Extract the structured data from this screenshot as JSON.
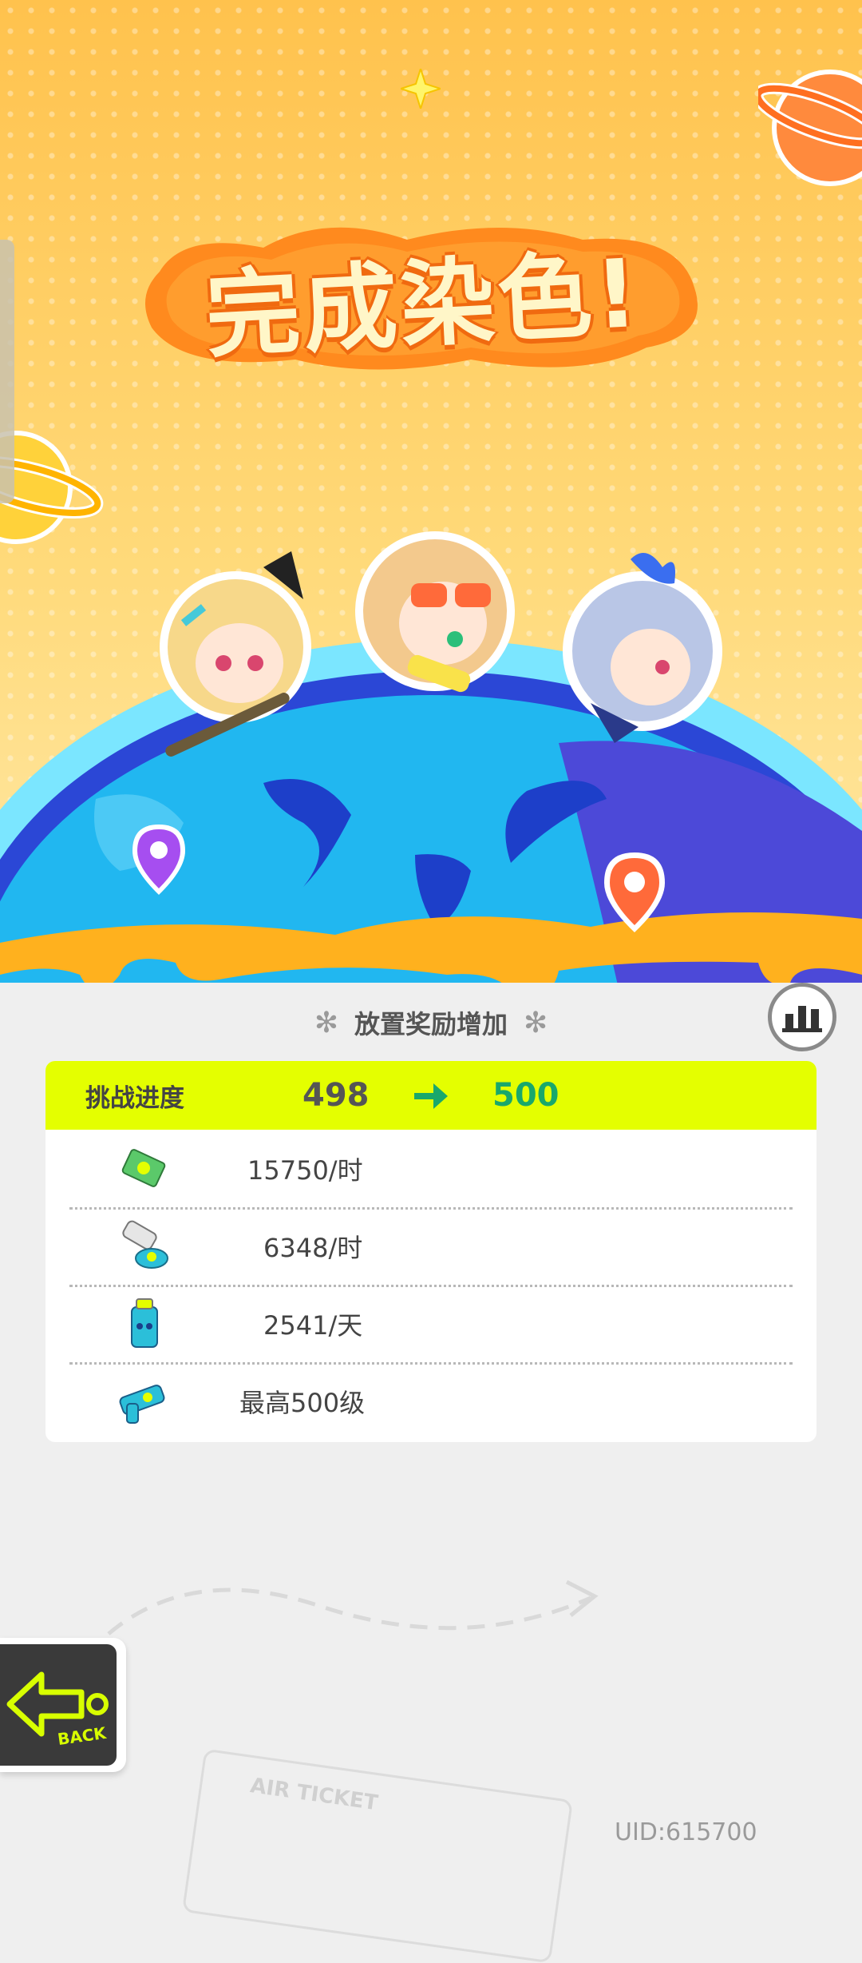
{
  "header": {
    "title": "完成染色!"
  },
  "bonus": {
    "title": "放置奖励增加"
  },
  "progress": {
    "label": "挑战进度",
    "from": "498",
    "to": "500"
  },
  "rewards": [
    {
      "icon": "cash-icon",
      "value": "15750/时"
    },
    {
      "icon": "paint-tube-icon",
      "value": "6348/时"
    },
    {
      "icon": "spray-can-icon",
      "value": "2541/天"
    },
    {
      "icon": "paint-gun-icon",
      "value": "最高500级"
    }
  ],
  "back": {
    "label": "BACK"
  },
  "footer": {
    "uid": "UID:615700"
  },
  "ticket": {
    "label": "AIR TICKET"
  },
  "colors": {
    "accent": "#e4ff00",
    "progress_target": "#19a86b",
    "title_outline": "#f06a10"
  }
}
